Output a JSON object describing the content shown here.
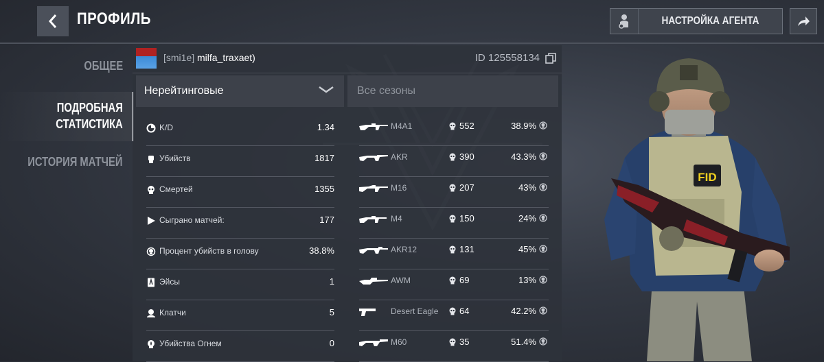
{
  "header": {
    "title": "ПРОФИЛЬ",
    "agent_button_label": "НАСТРОЙКА АГЕНТА"
  },
  "sidebar": {
    "tabs": [
      {
        "label": "ОБЩЕЕ",
        "active": false
      },
      {
        "label": "ПОДРОБНАЯ\nСТАТИСТИКА",
        "active": true
      },
      {
        "label": "ИСТОРИЯ МАТЧЕЙ",
        "active": false
      }
    ]
  },
  "profile": {
    "clan_tag": "[smi1e]",
    "username": "milfa_traxaet)",
    "id_text": "ID 125558134"
  },
  "filters": {
    "mode": "Нерейтинговые",
    "season": "Все сезоны"
  },
  "stats": [
    {
      "label": "K/D",
      "value": "1.34",
      "icon": "kd-icon"
    },
    {
      "label": "Убийств",
      "value": "1817",
      "icon": "fist-icon"
    },
    {
      "label": "Смертей",
      "value": "1355",
      "icon": "skull-icon"
    },
    {
      "label": "Сыграно матчей:",
      "value": "177",
      "icon": "play-icon"
    },
    {
      "label": "Процент убийств в голову",
      "value": "38.8%",
      "icon": "headshot-icon"
    },
    {
      "label": "Эйсы",
      "value": "1",
      "icon": "ace-card-icon"
    },
    {
      "label": "Клатчи",
      "value": "5",
      "icon": "clutch-icon"
    },
    {
      "label": "Убийства Огнем",
      "value": "0",
      "icon": "fire-kill-icon"
    }
  ],
  "weapons": [
    {
      "name": "M4A1",
      "kills": "552",
      "headshot_pct": "38.9%"
    },
    {
      "name": "AKR",
      "kills": "390",
      "headshot_pct": "43.3%"
    },
    {
      "name": "M16",
      "kills": "207",
      "headshot_pct": "43%"
    },
    {
      "name": "M4",
      "kills": "150",
      "headshot_pct": "24%"
    },
    {
      "name": "AKR12",
      "kills": "131",
      "headshot_pct": "45%"
    },
    {
      "name": "AWM",
      "kills": "69",
      "headshot_pct": "13%"
    },
    {
      "name": "Desert Eagle",
      "kills": "64",
      "headshot_pct": "42.2%"
    },
    {
      "name": "M60",
      "kills": "35",
      "headshot_pct": "51.4%"
    }
  ],
  "agent": {
    "patch_text": "FID"
  },
  "colors": {
    "panel_bg": "#2e323a",
    "accent": "#d9dce0",
    "text_dim": "#8d929b"
  }
}
